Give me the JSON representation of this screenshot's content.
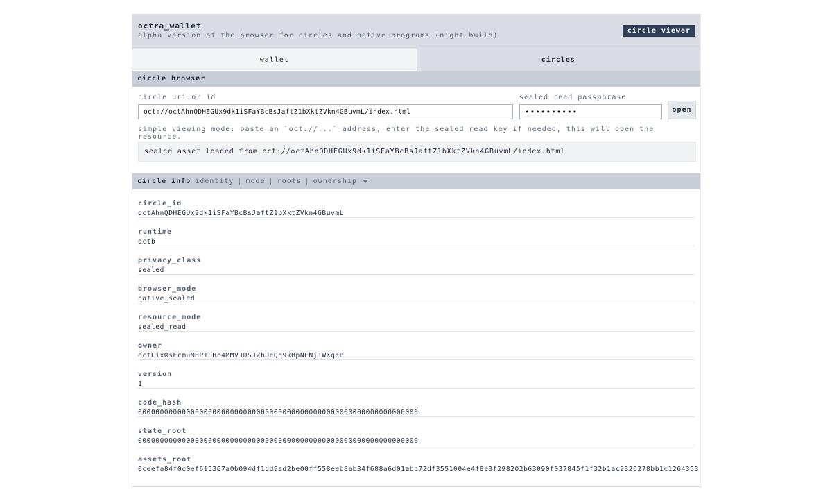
{
  "header": {
    "title": "octra_wallet",
    "subtitle": "alpha version of the browser for circles and native programs (night build)",
    "viewer_button": "circle viewer"
  },
  "tabs": [
    {
      "label": "wallet",
      "active": false
    },
    {
      "label": "circles",
      "active": true
    }
  ],
  "browser": {
    "section_title": "circle browser",
    "uri_label": "circle uri or id",
    "uri_value": "oct://octAhnQDHEGUx9dk1iSFaYBcBsJaftZ1bXktZVkn4GBuvmL/index.html",
    "pass_label": "sealed read passphrase",
    "pass_value": "••••••••••",
    "open_button": "open",
    "hint": "simple viewing mode: paste an `oct://...` address, enter the sealed read key if needed, this will open the resource.",
    "status": "sealed asset loaded from oct://octAhnQDHEGUx9dk1iSFaYBcBsJaftZ1bXktZVkn4GBuvmL/index.html"
  },
  "info": {
    "title": "circle info",
    "nav": [
      "identity",
      "mode",
      "roots",
      "ownership"
    ],
    "fields": [
      {
        "key": "circle_id",
        "value": "octAhnQDHEGUx9dk1iSFaYBcBsJaftZ1bXktZVkn4GBuvmL"
      },
      {
        "key": "runtime",
        "value": "octb"
      },
      {
        "key": "privacy_class",
        "value": "sealed"
      },
      {
        "key": "browser_mode",
        "value": "native_sealed"
      },
      {
        "key": "resource_mode",
        "value": "sealed_read"
      },
      {
        "key": "owner",
        "value": "octCixRsEcmuMHP1SHc4MMVJUSJZbUeQq9kBpNFNj1WKqeB"
      },
      {
        "key": "version",
        "value": "1"
      },
      {
        "key": "code_hash",
        "value": "0000000000000000000000000000000000000000000000000000000000000000"
      },
      {
        "key": "state_root",
        "value": "0000000000000000000000000000000000000000000000000000000000000000"
      },
      {
        "key": "assets_root",
        "value": "0ceefa84f0c0ef615367a0b094df1dd9ad2be00ff558eeb8ab34f688a6d01abc72df3551004e4f8e3f298202b63090f037845f1f32b1ac9326278bb1c1264353"
      }
    ]
  },
  "colors": {
    "header_bg": "#d9dde3",
    "section_bg": "#c8ced7",
    "button_dark": "#2e3f57"
  }
}
